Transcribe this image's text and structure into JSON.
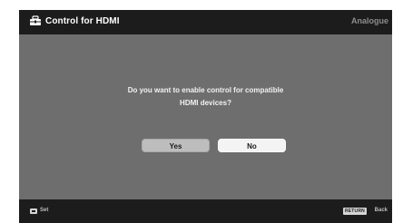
{
  "header": {
    "title": "Control for HDMI",
    "input_label": "Analogue",
    "icon": "toolbox-icon"
  },
  "dialog": {
    "message_line1": "Do you want to enable control for compatible",
    "message_line2": "HDMI devices?",
    "yes_label": "Yes",
    "no_label": "No",
    "selected": "No"
  },
  "footer": {
    "set_label": "Set",
    "return_key_label": "RETURN",
    "back_label": "Back"
  },
  "colors": {
    "background": "#6e6e6e",
    "bar": "#1c1c1c",
    "selected_button": "#f4f4f4",
    "unselected_button": "#bdbdbd"
  }
}
